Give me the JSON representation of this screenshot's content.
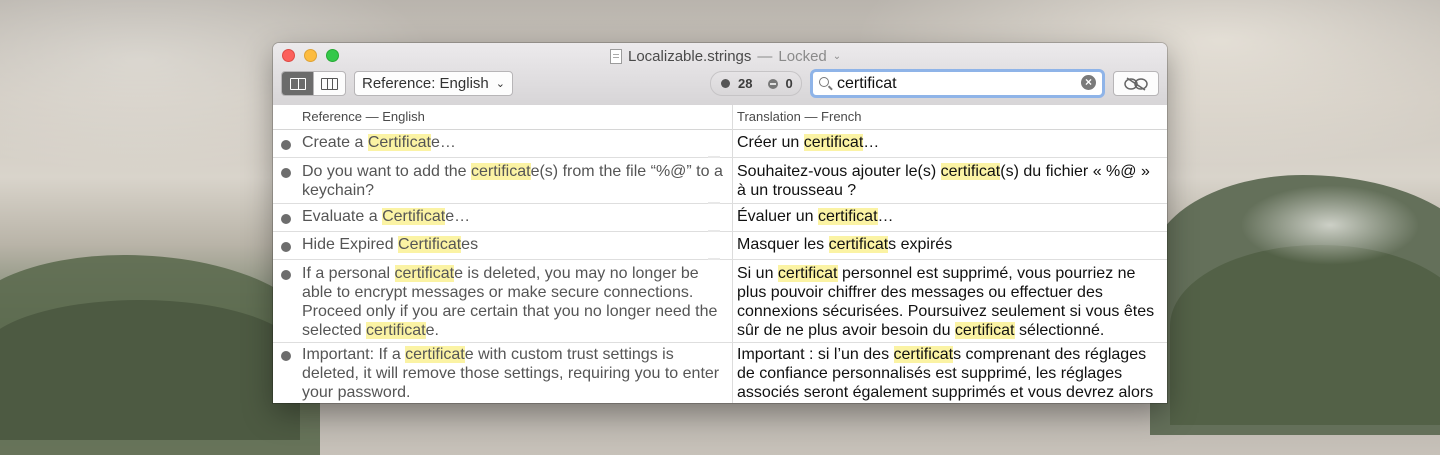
{
  "window": {
    "title": "Localizable.strings",
    "title_separator": "—",
    "title_state": "Locked",
    "title_chevron": "⌄"
  },
  "toolbar": {
    "view_mode_icons": [
      "split-view-icon",
      "three-column-icon"
    ],
    "reference_popup": "Reference: English",
    "popup_chevron": "⌄",
    "count_total": "28",
    "count_removed": "0",
    "search_value": "certificat",
    "clear_glyph": "×",
    "locked_button_icon": "locked-icon"
  },
  "table": {
    "header_reference": "Reference — English",
    "header_translation": "Translation — French",
    "rows": [
      {
        "ref": [
          "Create a ",
          "Certificat",
          "e…"
        ],
        "tr": [
          "Créer un ",
          "certificat",
          "…"
        ]
      },
      {
        "ref": [
          "Do you want to add the ",
          "certificat",
          "e(s) from the file “%@” to a keychain?"
        ],
        "tr": [
          "Souhaitez-vous ajouter le(s) ",
          "certificat",
          "(s) du fichier « %@ » à un trousseau ?"
        ]
      },
      {
        "ref": [
          "Evaluate a ",
          "Certificat",
          "e…"
        ],
        "tr": [
          "Évaluer un ",
          "certificat",
          "…"
        ]
      },
      {
        "ref": [
          "Hide Expired ",
          "Certificat",
          "es"
        ],
        "tr": [
          "Masquer les ",
          "certificat",
          "s expirés"
        ]
      },
      {
        "ref": [
          "If a personal ",
          "certificat",
          "e is deleted, you may no longer be able to encrypt messages or make secure connections. Proceed only if you are certain that you no longer need the selected ",
          "certificat",
          "e."
        ],
        "tr": [
          "Si un ",
          "certificat",
          " personnel est supprimé, vous pourriez ne plus pouvoir chiffrer des messages ou effectuer des connexions sécurisées. Poursuivez seulement si vous êtes sûr de ne plus avoir besoin du ",
          "certificat",
          " sélectionné."
        ]
      },
      {
        "ref": [
          "Important: If a ",
          "certificat",
          "e with custom trust settings is deleted, it will remove those settings, requiring you to enter your password."
        ],
        "tr": [
          "Important : si l’un des ",
          "certificat",
          "s comprenant des réglages de confiance personnalisés est supprimé, les réglages associés seront également supprimés et vous devrez alors saisir votre mot de passe."
        ]
      }
    ]
  },
  "colors": {
    "highlight": "#fbf3a4",
    "search_focus_ring": "#8fb4e8",
    "close": "#fc605c",
    "minimize": "#fdbc40",
    "zoom": "#34c84a"
  }
}
